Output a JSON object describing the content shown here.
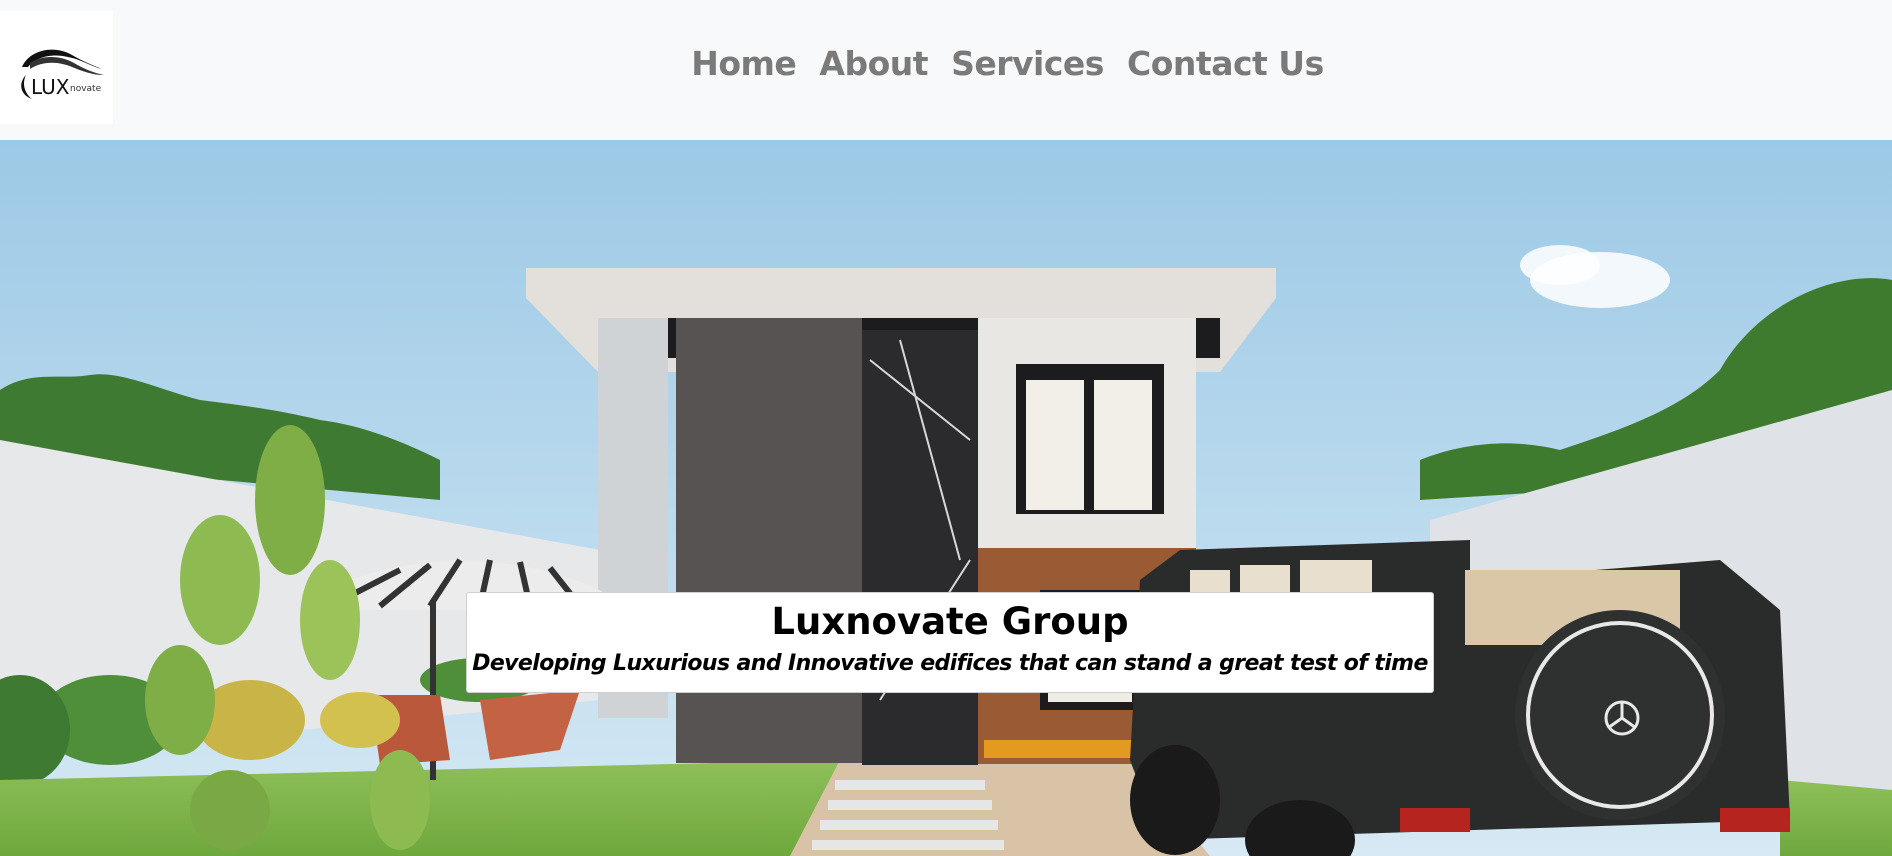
{
  "brand": {
    "logo_text_main": "LUX",
    "logo_text_sub": "novate"
  },
  "nav": {
    "items": [
      {
        "label": "Home"
      },
      {
        "label": "About"
      },
      {
        "label": "Services"
      },
      {
        "label": "Contact Us"
      }
    ]
  },
  "hero": {
    "title": "Luxnovate Group",
    "subtitle": "Developing Luxurious and Innovative edifices that can stand a great test of time"
  },
  "colors": {
    "navbar_bg": "#f8f9fa",
    "nav_link": "#7a7a7a",
    "caption_bg": "#ffffff"
  }
}
